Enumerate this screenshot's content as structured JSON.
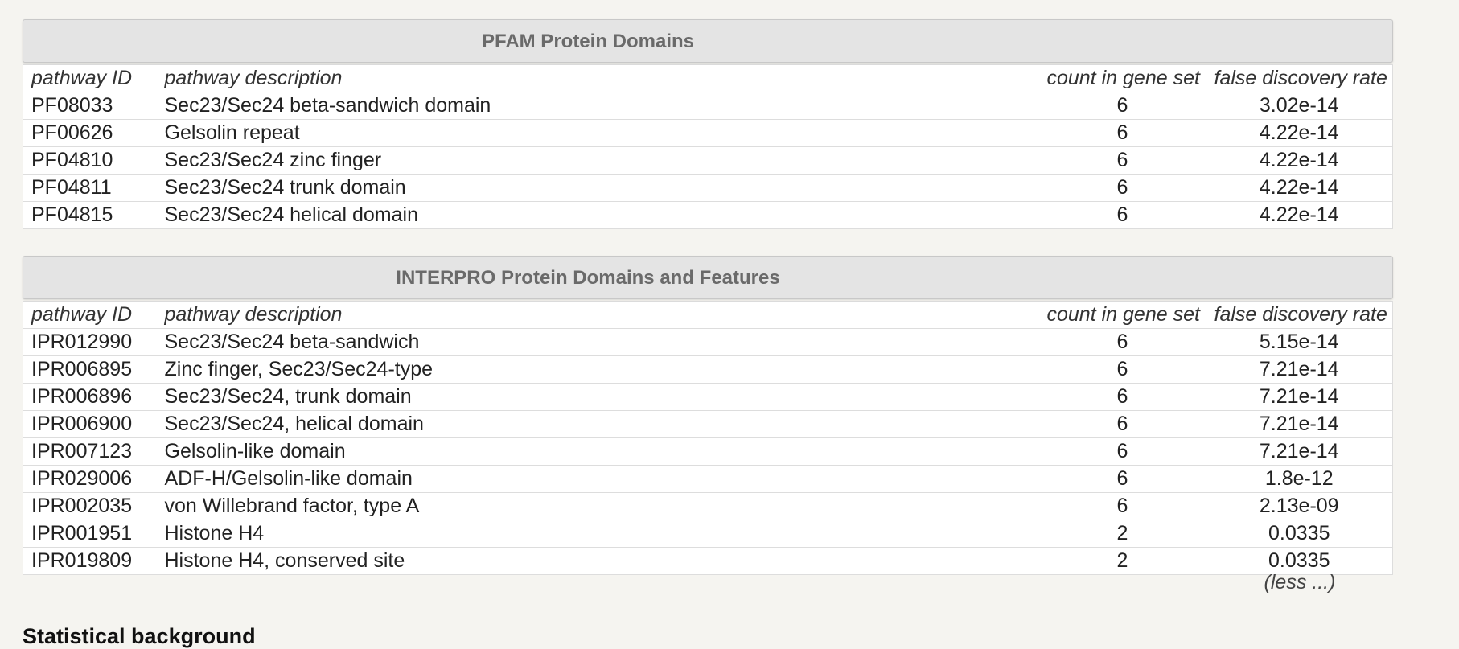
{
  "pfam": {
    "title": "PFAM Protein Domains",
    "headers": {
      "id": "pathway ID",
      "desc": "pathway description",
      "count": "count in gene set",
      "fdr": "false discovery rate"
    },
    "rows": [
      {
        "id": "PF08033",
        "desc": "Sec23/Sec24 beta-sandwich domain",
        "count": "6",
        "fdr": "3.02e-14"
      },
      {
        "id": "PF00626",
        "desc": "Gelsolin repeat",
        "count": "6",
        "fdr": "4.22e-14"
      },
      {
        "id": "PF04810",
        "desc": "Sec23/Sec24 zinc finger",
        "count": "6",
        "fdr": "4.22e-14"
      },
      {
        "id": "PF04811",
        "desc": "Sec23/Sec24 trunk domain",
        "count": "6",
        "fdr": "4.22e-14"
      },
      {
        "id": "PF04815",
        "desc": "Sec23/Sec24 helical domain",
        "count": "6",
        "fdr": "4.22e-14"
      }
    ]
  },
  "interpro": {
    "title": "INTERPRO Protein Domains and Features",
    "headers": {
      "id": "pathway ID",
      "desc": "pathway description",
      "count": "count in gene set",
      "fdr": "false discovery rate"
    },
    "rows": [
      {
        "id": "IPR012990",
        "desc": "Sec23/Sec24 beta-sandwich",
        "count": "6",
        "fdr": "5.15e-14"
      },
      {
        "id": "IPR006895",
        "desc": "Zinc finger, Sec23/Sec24-type",
        "count": "6",
        "fdr": "7.21e-14"
      },
      {
        "id": "IPR006896",
        "desc": "Sec23/Sec24, trunk domain",
        "count": "6",
        "fdr": "7.21e-14"
      },
      {
        "id": "IPR006900",
        "desc": "Sec23/Sec24, helical domain",
        "count": "6",
        "fdr": "7.21e-14"
      },
      {
        "id": "IPR007123",
        "desc": "Gelsolin-like domain",
        "count": "6",
        "fdr": "7.21e-14"
      },
      {
        "id": "IPR029006",
        "desc": "ADF-H/Gelsolin-like domain",
        "count": "6",
        "fdr": "1.8e-12"
      },
      {
        "id": "IPR002035",
        "desc": "von Willebrand factor, type A",
        "count": "6",
        "fdr": "2.13e-09"
      },
      {
        "id": "IPR001951",
        "desc": "Histone H4",
        "count": "2",
        "fdr": "0.0335"
      },
      {
        "id": "IPR019809",
        "desc": "Histone H4, conserved site",
        "count": "2",
        "fdr": "0.0335"
      }
    ],
    "less_link": "(less ...)"
  },
  "next_section": {
    "title": "Statistical background"
  }
}
